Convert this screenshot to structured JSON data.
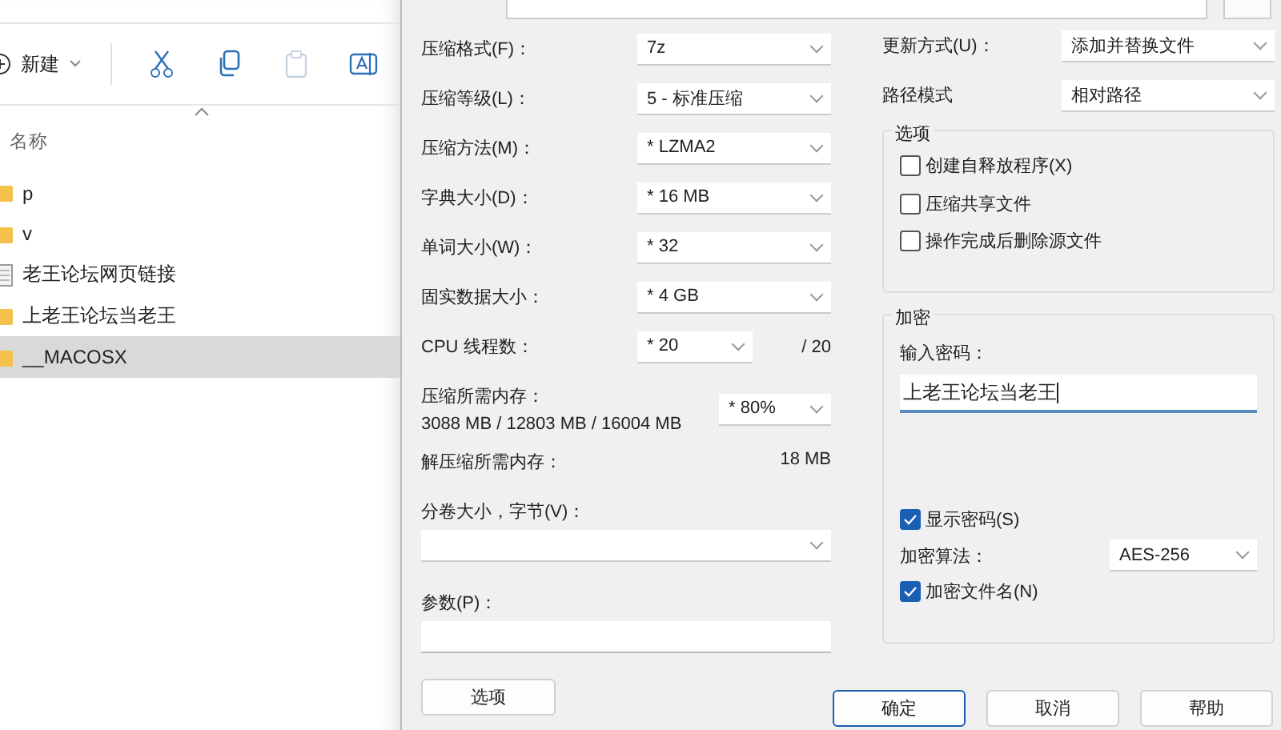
{
  "explorer": {
    "new_label": "新建",
    "tools": [
      {
        "kind": "cut",
        "disabled": false
      },
      {
        "kind": "copy",
        "disabled": false
      },
      {
        "kind": "paste",
        "disabled": true
      },
      {
        "kind": "rename",
        "disabled": false
      }
    ],
    "column": "名称",
    "files": [
      {
        "name": "p",
        "kind": "folder",
        "selected": false
      },
      {
        "name": "v",
        "kind": "folder",
        "selected": false
      },
      {
        "name": "老王论坛网页链接",
        "kind": "file",
        "selected": false
      },
      {
        "name": "上老王论坛当老王",
        "kind": "folder",
        "selected": false
      },
      {
        "name": "__MACOSX",
        "kind": "folder",
        "selected": true
      }
    ]
  },
  "dialog": {
    "settings": [
      {
        "label": "压缩格式(F)：",
        "value": "7z"
      },
      {
        "label": "压缩等级(L)：",
        "value": "5 - 标准压缩"
      },
      {
        "label": "压缩方法(M)：",
        "value": "* LZMA2"
      },
      {
        "label": "字典大小(D)：",
        "value": "* 16 MB"
      },
      {
        "label": "单词大小(W)：",
        "value": "* 32"
      },
      {
        "label": "固实数据大小：",
        "value": "* 4 GB"
      }
    ],
    "cpu": {
      "label": "CPU 线程数：",
      "value": "* 20",
      "max": "/ 20"
    },
    "memory": {
      "label": "压缩所需内存：",
      "usage": "3088 MB / 12803 MB / 16004 MB",
      "percent": "* 80%"
    },
    "decompress": {
      "label": "解压缩所需内存：",
      "value": "18 MB"
    },
    "volume": {
      "label": "分卷大小，字节(V)："
    },
    "params": {
      "label": "参数(P)："
    },
    "options_button": "选项",
    "update": {
      "label": "更新方式(U)：",
      "value": "添加并替换文件"
    },
    "path_mode": {
      "label": "路径模式",
      "value": "相对路径"
    },
    "options": {
      "title": "选项",
      "checkboxes": [
        {
          "label": "创建自释放程序(X)",
          "checked": false
        },
        {
          "label": "压缩共享文件",
          "checked": false
        },
        {
          "label": "操作完成后删除源文件",
          "checked": false
        }
      ]
    },
    "encryption": {
      "title": "加密",
      "password_label": "输入密码：",
      "password": "上老王论坛当老王",
      "show_password": {
        "label": "显示密码(S)",
        "checked": true
      },
      "algorithm": {
        "label": "加密算法：",
        "value": "AES-256"
      },
      "encrypt_names": {
        "label": "加密文件名(N)",
        "checked": true
      }
    },
    "buttons": [
      {
        "label": "确定",
        "default": true
      },
      {
        "label": "取消",
        "default": false
      },
      {
        "label": "帮助",
        "default": false
      }
    ]
  }
}
